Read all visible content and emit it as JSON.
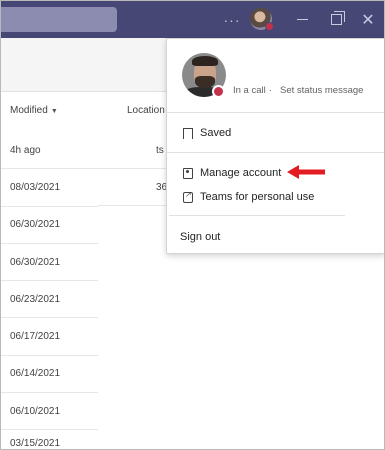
{
  "titlebar": {
    "more_glyph": "···",
    "close_glyph": "✕"
  },
  "file_list": {
    "columns": {
      "modified": "Modified",
      "location": "Location"
    },
    "rows": [
      {
        "modified": "4h ago"
      },
      {
        "modified": "08/03/2021"
      },
      {
        "modified": "06/30/2021"
      },
      {
        "modified": "06/30/2021"
      },
      {
        "modified": "06/23/2021"
      },
      {
        "modified": "06/17/2021"
      },
      {
        "modified": "06/14/2021"
      },
      {
        "modified": "06/10/2021"
      },
      {
        "modified": "03/15/2021"
      }
    ],
    "location_fragments": [
      "ts",
      "36"
    ]
  },
  "profile_menu": {
    "status": "In a call",
    "status_separator": "·",
    "set_status_label": "Set status message",
    "saved_label": "Saved",
    "manage_account_label": "Manage account",
    "teams_personal_label": "Teams for personal use",
    "sign_out_label": "Sign out"
  },
  "colors": {
    "titlebar": "#464775",
    "presence_busy": "#c4314b",
    "annotation_arrow": "#e31b23"
  },
  "icons": {
    "saved": "bookmark-icon",
    "manage_account": "id-card-icon",
    "teams_personal": "external-link-icon"
  }
}
